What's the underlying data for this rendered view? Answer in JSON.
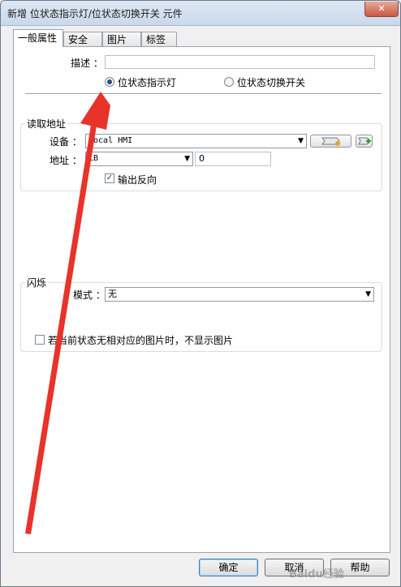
{
  "window": {
    "title": "新增 位状态指示灯/位状态切换开关 元件",
    "close_glyph": "✕"
  },
  "tabs": [
    {
      "label": "一般属性",
      "active": true
    },
    {
      "label": "安全"
    },
    {
      "label": "图片"
    },
    {
      "label": "标签"
    }
  ],
  "general": {
    "description_label": "描述 ：",
    "description_value": "",
    "mode_options": [
      {
        "label": "位状态指示灯",
        "selected": true
      },
      {
        "label": "位状态切换开关",
        "selected": false
      }
    ]
  },
  "read_address": {
    "title": "读取地址",
    "device_label": "设备 ：",
    "device_value": "Local HMI",
    "address_label": "地址 ：",
    "address_type": "LB",
    "address_value": "0",
    "invert_output_label": "输出反向",
    "invert_output_checked": true
  },
  "blink": {
    "title": "闪烁",
    "mode_label": "模式 ：",
    "mode_value": "无",
    "no_picture_label": "若当前状态无相对应的图片时，不显示图片",
    "no_picture_checked": false
  },
  "buttons": {
    "ok": "确定",
    "cancel": "取消",
    "help": "帮助"
  },
  "watermark": "Baidu经验",
  "annotation": {
    "arrow_color": "#e8332a"
  },
  "icons": {
    "dropdown": "▼",
    "check": "✓"
  }
}
